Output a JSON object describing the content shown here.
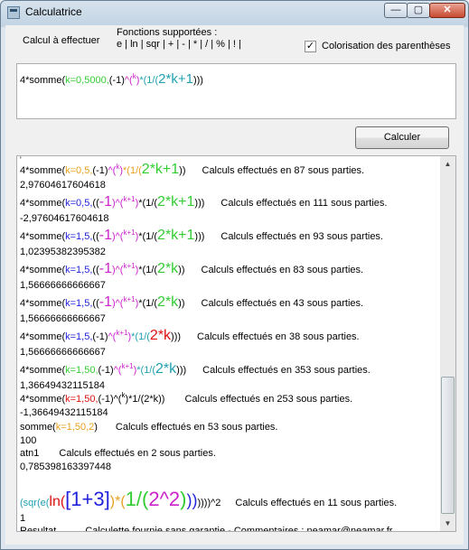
{
  "window": {
    "title": "Calculatrice",
    "controls": {
      "minimize": "—",
      "maximize": "▢",
      "close": "✕"
    }
  },
  "header": {
    "calc_label": "Calcul à effectuer",
    "functions_title": "Fonctions supportées :",
    "functions_list": "e | ln | sqr | + | - | * | / | % | ! |",
    "colorize_label": "Colorisation des parenthèses",
    "colorize_checked": "✓"
  },
  "input": {
    "parts": [
      {
        "t": "4*somme(",
        "c": "black",
        "s": 11
      },
      {
        "t": "k=0,5000,",
        "c": "green",
        "s": 11
      },
      {
        "t": "(-1)",
        "c": "black",
        "s": 11
      },
      {
        "t": "^(",
        "c": "mag",
        "s": 11
      },
      {
        "t": "k",
        "c": "mag",
        "s": 8,
        "sup": true
      },
      {
        "t": ")",
        "c": "mag",
        "s": 11
      },
      {
        "t": "*(1/(",
        "c": "cyan",
        "s": 11
      },
      {
        "t": "2*k+1",
        "c": "cyan",
        "s": 15
      },
      {
        "t": ")))",
        "c": "black",
        "s": 11
      }
    ]
  },
  "calculate_button": "Calculer",
  "output": {
    "lines": [
      {
        "h": 4,
        "parts": [
          {
            "t": "'",
            "c": "black",
            "s": 9
          }
        ]
      },
      {
        "h": 18,
        "parts": [
          {
            "t": "4*somme(",
            "c": "black",
            "s": 11
          },
          {
            "t": "k=0,5,",
            "c": "orange",
            "s": 11
          },
          {
            "t": "(-1)",
            "c": "black",
            "s": 11
          },
          {
            "t": "^(",
            "c": "mag",
            "s": 11
          },
          {
            "t": "k",
            "c": "mag",
            "s": 8,
            "sup": true
          },
          {
            "t": ")",
            "c": "mag",
            "s": 11
          },
          {
            "t": "*(1/(",
            "c": "orange",
            "s": 11
          },
          {
            "t": "2*k+1",
            "c": "green",
            "s": 16
          },
          {
            "t": "))",
            "c": "black",
            "s": 11
          },
          {
            "t": "Calculs effectués en 87 sous parties.",
            "c": "black",
            "s": 11,
            "gap": 18
          }
        ]
      },
      {
        "h": 16,
        "parts": [
          {
            "t": "2,97604617604618",
            "c": "black",
            "s": 11
          }
        ]
      },
      {
        "h": 21,
        "parts": [
          {
            "t": "4*somme(",
            "c": "black",
            "s": 11
          },
          {
            "t": "k=0,5,",
            "c": "blue",
            "s": 11
          },
          {
            "t": "((",
            "c": "black",
            "s": 11
          },
          {
            "t": "-1",
            "c": "mag",
            "s": 16
          },
          {
            "t": ")",
            "c": "mag",
            "s": 11
          },
          {
            "t": "^(",
            "c": "mag",
            "s": 11
          },
          {
            "t": "k+1",
            "c": "mag",
            "s": 8,
            "sup": true
          },
          {
            "t": ")",
            "c": "mag",
            "s": 11
          },
          {
            "t": "*(1/(",
            "c": "black",
            "s": 11
          },
          {
            "t": "2*k+1",
            "c": "green",
            "s": 16
          },
          {
            "t": ")))",
            "c": "black",
            "s": 11
          },
          {
            "t": "Calculs effectués en 111 sous parties.",
            "c": "black",
            "s": 11,
            "gap": 18
          }
        ]
      },
      {
        "h": 16,
        "parts": [
          {
            "t": "-2,97604617604618",
            "c": "black",
            "s": 11
          }
        ]
      },
      {
        "h": 21,
        "parts": [
          {
            "t": "4*somme(",
            "c": "black",
            "s": 11
          },
          {
            "t": "k=1,5,",
            "c": "blue",
            "s": 11
          },
          {
            "t": "((",
            "c": "black",
            "s": 11
          },
          {
            "t": "-1",
            "c": "mag",
            "s": 16
          },
          {
            "t": ")",
            "c": "mag",
            "s": 11
          },
          {
            "t": "^(",
            "c": "mag",
            "s": 11
          },
          {
            "t": "k+1",
            "c": "mag",
            "s": 8,
            "sup": true
          },
          {
            "t": ")",
            "c": "mag",
            "s": 11
          },
          {
            "t": "*(1/(",
            "c": "black",
            "s": 11
          },
          {
            "t": "2*k+1",
            "c": "green",
            "s": 16
          },
          {
            "t": ")))",
            "c": "black",
            "s": 11
          },
          {
            "t": "Calculs effectués en 93 sous parties.",
            "c": "black",
            "s": 11,
            "gap": 18
          }
        ]
      },
      {
        "h": 16,
        "parts": [
          {
            "t": "1,02395382395382",
            "c": "black",
            "s": 11
          }
        ]
      },
      {
        "h": 21,
        "parts": [
          {
            "t": "4*somme(",
            "c": "black",
            "s": 11
          },
          {
            "t": "k=1,5,",
            "c": "blue",
            "s": 11
          },
          {
            "t": "((",
            "c": "black",
            "s": 11
          },
          {
            "t": "-1",
            "c": "mag",
            "s": 16
          },
          {
            "t": ")",
            "c": "mag",
            "s": 11
          },
          {
            "t": "^(",
            "c": "mag",
            "s": 11
          },
          {
            "t": "k+1",
            "c": "mag",
            "s": 8,
            "sup": true
          },
          {
            "t": ")",
            "c": "mag",
            "s": 11
          },
          {
            "t": "*(1/(",
            "c": "black",
            "s": 11
          },
          {
            "t": "2*k",
            "c": "green",
            "s": 16
          },
          {
            "t": "))",
            "c": "black",
            "s": 11
          },
          {
            "t": "Calculs effectués en 83 sous parties.",
            "c": "black",
            "s": 11,
            "gap": 18
          }
        ]
      },
      {
        "h": 16,
        "parts": [
          {
            "t": "1,56666666666667",
            "c": "black",
            "s": 11
          }
        ]
      },
      {
        "h": 21,
        "parts": [
          {
            "t": "4*somme(",
            "c": "black",
            "s": 11
          },
          {
            "t": "k=1,5,",
            "c": "blue",
            "s": 11
          },
          {
            "t": "((",
            "c": "black",
            "s": 11
          },
          {
            "t": "-1",
            "c": "mag",
            "s": 16
          },
          {
            "t": ")",
            "c": "mag",
            "s": 11
          },
          {
            "t": "^(",
            "c": "mag",
            "s": 11
          },
          {
            "t": "k+1",
            "c": "mag",
            "s": 8,
            "sup": true
          },
          {
            "t": ")",
            "c": "mag",
            "s": 11
          },
          {
            "t": "*(1/(",
            "c": "black",
            "s": 11
          },
          {
            "t": "2*k",
            "c": "green",
            "s": 16
          },
          {
            "t": "))",
            "c": "black",
            "s": 11
          },
          {
            "t": "Calculs effectués en 43 sous parties.",
            "c": "black",
            "s": 11,
            "gap": 18
          }
        ]
      },
      {
        "h": 16,
        "parts": [
          {
            "t": "1,56666666666667",
            "c": "black",
            "s": 11
          }
        ]
      },
      {
        "h": 21,
        "parts": [
          {
            "t": "4*somme(",
            "c": "black",
            "s": 11
          },
          {
            "t": "k=1,5,",
            "c": "blue",
            "s": 11
          },
          {
            "t": "(-1)",
            "c": "black",
            "s": 11
          },
          {
            "t": "^(",
            "c": "mag",
            "s": 11
          },
          {
            "t": "k+1",
            "c": "mag",
            "s": 8,
            "sup": true
          },
          {
            "t": ")",
            "c": "mag",
            "s": 11
          },
          {
            "t": "*(1/(",
            "c": "cyan",
            "s": 11
          },
          {
            "t": "2*k",
            "c": "red",
            "s": 16
          },
          {
            "t": ")))",
            "c": "black",
            "s": 11
          },
          {
            "t": "Calculs effectués en 38 sous parties.",
            "c": "black",
            "s": 11,
            "gap": 18
          }
        ]
      },
      {
        "h": 16,
        "parts": [
          {
            "t": "1,56666666666667",
            "c": "black",
            "s": 11
          }
        ]
      },
      {
        "h": 21,
        "parts": [
          {
            "t": "4*somme(",
            "c": "black",
            "s": 11
          },
          {
            "t": "k=1,50,",
            "c": "green",
            "s": 11
          },
          {
            "t": "(-1)",
            "c": "black",
            "s": 11
          },
          {
            "t": "^(",
            "c": "mag",
            "s": 11
          },
          {
            "t": "k+1",
            "c": "mag",
            "s": 8,
            "sup": true
          },
          {
            "t": ")",
            "c": "mag",
            "s": 11
          },
          {
            "t": "*(1/(",
            "c": "cyan",
            "s": 11
          },
          {
            "t": "2*k",
            "c": "cyan",
            "s": 16
          },
          {
            "t": ")))",
            "c": "black",
            "s": 11
          },
          {
            "t": "Calculs effectués en 353 sous parties.",
            "c": "black",
            "s": 11,
            "gap": 18
          }
        ]
      },
      {
        "h": 16,
        "parts": [
          {
            "t": "1,36649432115184",
            "c": "black",
            "s": 11
          }
        ]
      },
      {
        "h": 14,
        "parts": [
          {
            "t": "4*somme(",
            "c": "black",
            "s": 11
          },
          {
            "t": "k=1,50,",
            "c": "red",
            "s": 11
          },
          {
            "t": "(-1)",
            "c": "black",
            "s": 11
          },
          {
            "t": "^(",
            "c": "black",
            "s": 11
          },
          {
            "t": "k",
            "c": "black",
            "s": 8,
            "sup": true
          },
          {
            "t": ")",
            "c": "black",
            "s": 11
          },
          {
            "t": "*1/(2*k))",
            "c": "black",
            "s": 11
          },
          {
            "t": "Calculs effectués en 253 sous parties.",
            "c": "black",
            "s": 11,
            "gap": 22
          }
        ]
      },
      {
        "h": 16,
        "parts": [
          {
            "t": "-1,36649432115184",
            "c": "black",
            "s": 11
          }
        ]
      },
      {
        "h": 16,
        "parts": [
          {
            "t": "somme(",
            "c": "black",
            "s": 11
          },
          {
            "t": "k=1,50,2",
            "c": "orange",
            "s": 11
          },
          {
            "t": ")",
            "c": "black",
            "s": 11
          },
          {
            "t": "Calculs effectués en 53 sous parties.",
            "c": "black",
            "s": 11,
            "gap": 20
          }
        ]
      },
      {
        "h": 14,
        "parts": [
          {
            "t": "100",
            "c": "black",
            "s": 11
          }
        ]
      },
      {
        "h": 14,
        "parts": [
          {
            "t": "atn1",
            "c": "black",
            "s": 11
          },
          {
            "t": "Calculs effectués en 2 sous parties.",
            "c": "black",
            "s": 11,
            "gap": 22
          }
        ]
      },
      {
        "h": 16,
        "parts": [
          {
            "t": "0,785398163397448",
            "c": "black",
            "s": 11
          }
        ]
      },
      {
        "h": 14,
        "parts": []
      },
      {
        "h": 28,
        "parts": [
          {
            "t": "(sqr(e(",
            "c": "cyan",
            "s": 11
          },
          {
            "t": "ln(",
            "c": "red",
            "s": 16
          },
          {
            "t": "[",
            "c": "blue",
            "s": 22
          },
          {
            "t": "1",
            "c": "blue",
            "s": 22
          },
          {
            "t": "+3",
            "c": "blue",
            "s": 22
          },
          {
            "t": "]",
            "c": "blue",
            "s": 22
          },
          {
            "t": ")*(",
            "c": "orange",
            "s": 16
          },
          {
            "t": "1",
            "c": "green",
            "s": 22
          },
          {
            "t": "/(",
            "c": "green",
            "s": 22
          },
          {
            "t": "2^2",
            "c": "mag",
            "s": 22
          },
          {
            "t": ")",
            "c": "green",
            "s": 22
          },
          {
            "t": "))",
            "c": "blue",
            "s": 18
          },
          {
            "t": "))))",
            "c": "black",
            "s": 11
          },
          {
            "t": "^2",
            "c": "black",
            "s": 11
          },
          {
            "t": "Calculs effectués en 11 sous parties.",
            "c": "black",
            "s": 11,
            "gap": 16
          }
        ]
      },
      {
        "h": 14,
        "parts": [
          {
            "t": "1",
            "c": "black",
            "s": 11
          }
        ]
      },
      {
        "h": 14,
        "parts": [
          {
            "t": "Resultat",
            "c": "black",
            "s": 11
          },
          {
            "t": "Calculette fournie sans garantie - Commentaires : neamar@neamar.fr",
            "c": "black",
            "s": 11,
            "gap": 32
          }
        ]
      }
    ]
  }
}
